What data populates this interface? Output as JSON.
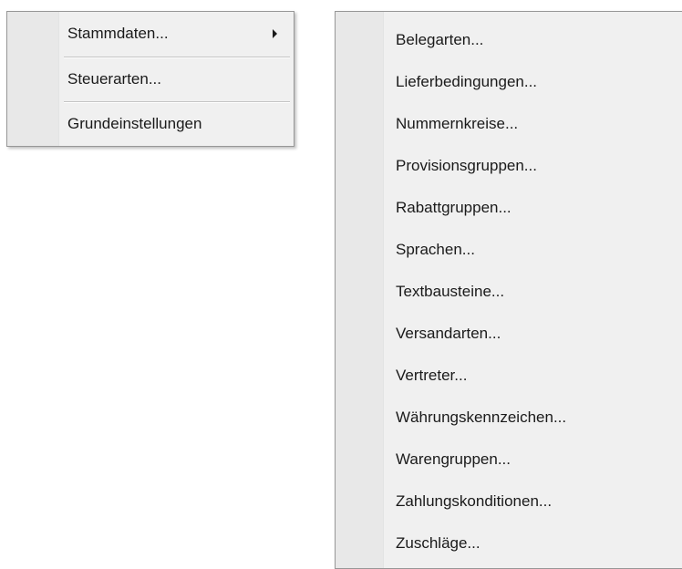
{
  "main_menu": {
    "items": [
      {
        "label": "Stammdaten...",
        "has_submenu": true
      },
      {
        "label": "Steuerarten..."
      },
      {
        "label": "Grundeinstellungen"
      }
    ]
  },
  "submenu": {
    "items": [
      {
        "label": "Belegarten..."
      },
      {
        "label": "Lieferbedingungen..."
      },
      {
        "label": "Nummernkreise..."
      },
      {
        "label": "Provisionsgruppen..."
      },
      {
        "label": "Rabattgruppen..."
      },
      {
        "label": "Sprachen..."
      },
      {
        "label": "Textbausteine..."
      },
      {
        "label": "Versandarten..."
      },
      {
        "label": "Vertreter..."
      },
      {
        "label": "Währungskennzeichen..."
      },
      {
        "label": "Warengruppen..."
      },
      {
        "label": "Zahlungskonditionen..."
      },
      {
        "label": "Zuschläge..."
      }
    ]
  }
}
